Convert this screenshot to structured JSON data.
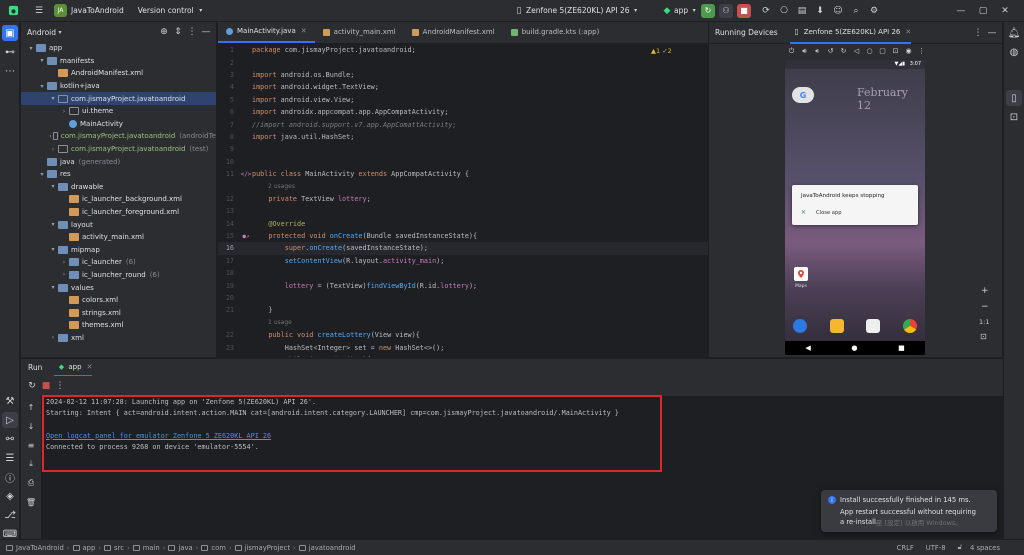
{
  "titlebar": {
    "project": "JavaToAndroid",
    "vcs": "Version control",
    "device": "Zenfone 5(ZE620KL) API 26",
    "run_config": "app"
  },
  "project_panel": {
    "title": "Android",
    "items": [
      {
        "depth": 0,
        "arrow": "▾",
        "icon": "folder",
        "label": "app",
        "extra": ""
      },
      {
        "depth": 1,
        "arrow": "▾",
        "icon": "folder",
        "label": "manifests",
        "extra": ""
      },
      {
        "depth": 2,
        "arrow": "",
        "icon": "xml",
        "label": "AndroidManifest.xml",
        "extra": ""
      },
      {
        "depth": 1,
        "arrow": "▾",
        "icon": "folder",
        "label": "kotlin+java",
        "extra": ""
      },
      {
        "depth": 2,
        "arrow": "▾",
        "icon": "package",
        "label": "com.jismayProject.javatoandroid",
        "extra": "",
        "selected": true
      },
      {
        "depth": 3,
        "arrow": "›",
        "icon": "package",
        "label": "ui.theme",
        "extra": ""
      },
      {
        "depth": 3,
        "arrow": "",
        "icon": "class",
        "label": "MainActivity",
        "extra": ""
      },
      {
        "depth": 2,
        "arrow": "›",
        "icon": "package",
        "label": "com.jismayProject.javatoandroid",
        "extra": "(androidTe",
        "green": true
      },
      {
        "depth": 2,
        "arrow": "›",
        "icon": "package",
        "label": "com.jismayProject.javatoandroid",
        "extra": "(test)",
        "green": true
      },
      {
        "depth": 1,
        "arrow": "",
        "icon": "folder",
        "label": "java",
        "extra": "(generated)"
      },
      {
        "depth": 1,
        "arrow": "▾",
        "icon": "folder",
        "label": "res",
        "extra": ""
      },
      {
        "depth": 2,
        "arrow": "▾",
        "icon": "folder",
        "label": "drawable",
        "extra": ""
      },
      {
        "depth": 3,
        "arrow": "",
        "icon": "xml",
        "label": "ic_launcher_background.xml",
        "extra": ""
      },
      {
        "depth": 3,
        "arrow": "",
        "icon": "xml",
        "label": "ic_launcher_foreground.xml",
        "extra": ""
      },
      {
        "depth": 2,
        "arrow": "▾",
        "icon": "folder",
        "label": "layout",
        "extra": ""
      },
      {
        "depth": 3,
        "arrow": "",
        "icon": "xml",
        "label": "activity_main.xml",
        "extra": ""
      },
      {
        "depth": 2,
        "arrow": "▾",
        "icon": "folder",
        "label": "mipmap",
        "extra": ""
      },
      {
        "depth": 3,
        "arrow": "›",
        "icon": "folder",
        "label": "ic_launcher",
        "extra": "(6)"
      },
      {
        "depth": 3,
        "arrow": "›",
        "icon": "folder",
        "label": "ic_launcher_round",
        "extra": "(6)"
      },
      {
        "depth": 2,
        "arrow": "▾",
        "icon": "folder",
        "label": "values",
        "extra": ""
      },
      {
        "depth": 3,
        "arrow": "",
        "icon": "xml",
        "label": "colors.xml",
        "extra": ""
      },
      {
        "depth": 3,
        "arrow": "",
        "icon": "xml",
        "label": "strings.xml",
        "extra": ""
      },
      {
        "depth": 3,
        "arrow": "",
        "icon": "xml",
        "label": "themes.xml",
        "extra": ""
      },
      {
        "depth": 2,
        "arrow": "›",
        "icon": "folder",
        "label": "xml",
        "extra": ""
      }
    ]
  },
  "editor": {
    "tabs": [
      {
        "label": "MainActivity.java",
        "active": true
      },
      {
        "label": "activity_main.xml",
        "active": false
      },
      {
        "label": "AndroidManifest.xml",
        "active": false
      },
      {
        "label": "build.gradle.kts (:app)",
        "active": false
      }
    ],
    "inspection": "▲1 ✓2",
    "lines": [
      {
        "n": "1",
        "text": "package com.jismayProject.javatoandroid;"
      },
      {
        "n": "2",
        "text": ""
      },
      {
        "n": "3",
        "text": "import android.os.Bundle;"
      },
      {
        "n": "4",
        "text": "import android.widget.TextView;"
      },
      {
        "n": "5",
        "text": "import android.view.View;"
      },
      {
        "n": "6",
        "text": "import androidx.appcompat.app.AppCompatActivity;"
      },
      {
        "n": "7",
        "text": "//import android.support.v7.app.AppComattActivity;"
      },
      {
        "n": "8",
        "text": "import java.util.HashSet;"
      },
      {
        "n": "9",
        "text": ""
      },
      {
        "n": "10",
        "text": ""
      },
      {
        "n": "11",
        "text": "public class MainActivity extends AppCompatActivity {",
        "gutter": "</>"
      },
      {
        "n": "",
        "text": "2 usages",
        "hint": true
      },
      {
        "n": "12",
        "text": "    private TextView lottery;"
      },
      {
        "n": "13",
        "text": ""
      },
      {
        "n": "14",
        "text": "    @Override"
      },
      {
        "n": "15",
        "text": "    protected void onCreate(Bundle savedInstanceState){",
        "gutter": "●↗"
      },
      {
        "n": "16",
        "text": "        super.onCreate(savedInstanceState);",
        "current": true
      },
      {
        "n": "17",
        "text": "        setContentView(R.layout.activity_main);"
      },
      {
        "n": "18",
        "text": ""
      },
      {
        "n": "19",
        "text": "        lottery = (TextView)findViewById(R.id.lottery);"
      },
      {
        "n": "20",
        "text": ""
      },
      {
        "n": "21",
        "text": "    }"
      },
      {
        "n": "",
        "text": "1 usage",
        "hint": true
      },
      {
        "n": "22",
        "text": "    public void createLottery(View view){"
      },
      {
        "n": "23",
        "text": "        HashSet<Integer> set = new HashSet<>();"
      },
      {
        "n": "24",
        "text": "        while (set.size()<6){"
      },
      {
        "n": "25",
        "text": "            set.add((int)(Math.random() * 49 + 1));"
      }
    ]
  },
  "devices": {
    "title": "Running Devices",
    "tab": "Zenfone 5(ZE620KL) API 26",
    "phone": {
      "date": "February 12",
      "time": "3:07",
      "dialog_title": "JavaToAndroid keeps stopping",
      "dialog_action": "Close app",
      "maps_label": "Maps"
    },
    "zoom_label": "1:1"
  },
  "run": {
    "tab_run": "Run",
    "tab_app": "app",
    "console": [
      "2024-02-12 11:07:28: Launching app on 'Zenfone 5(ZE620KL) API 26'.",
      "Starting: Intent { act=android.intent.action.MAIN cat=[android.intent.category.LAUNCHER] cmp=com.jismayProject.javatoandroid/.MainActivity }",
      "",
      "",
      "Connected to process 9268 on device 'emulator-5554'."
    ],
    "link": "Open logcat panel for emulator Zenfone 5 ZE620KL API 26"
  },
  "notification": {
    "line1": "Install successfully finished in 145 ms.",
    "line2": "App restart successful without requiring",
    "line3": "a re-install."
  },
  "watermark": "至 [設定] 以啟用 Windows。",
  "status": {
    "crumbs": [
      "JavaToAndroid",
      "app",
      "src",
      "main",
      "java",
      "com",
      "jismayProject",
      "javatoandroid"
    ],
    "line_ending": "CRLF",
    "encoding": "UTF-8",
    "indent": "4 spaces"
  },
  "colors": {
    "accent": "#3574f0",
    "selection": "#2e436e",
    "highlight_box": "#e0262a",
    "run_green": "#4e9a4f",
    "stop_red": "#c94f4f"
  }
}
